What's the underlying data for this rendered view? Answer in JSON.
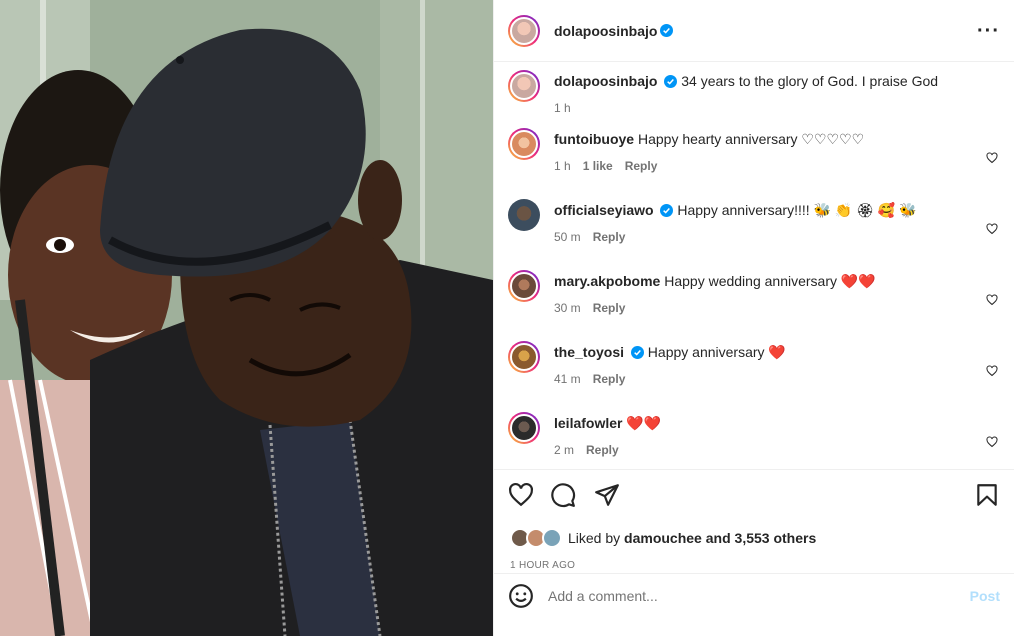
{
  "post": {
    "author": "dolapoosinbajo",
    "caption": "34 years to the glory of God. I praise God",
    "caption_time": "1 h"
  },
  "comments": [
    {
      "user": "funtoibuoye",
      "verified": false,
      "text": "Happy hearty anniversary ♡♡♡♡♡",
      "time": "1 h",
      "likes": "1 like",
      "reply": "Reply",
      "avatar_color": "#d98a5f"
    },
    {
      "user": "officialseyiawo",
      "verified": true,
      "text": "Happy anniversary!!!! 🐝 👏 🏵 🥰 🐝",
      "time": "50 m",
      "likes": "",
      "reply": "Reply",
      "avatar_color": "#3c4d5e"
    },
    {
      "user": "mary.akpobome",
      "verified": false,
      "text": "Happy wedding anniversary ❤️❤️",
      "time": "30 m",
      "likes": "",
      "reply": "Reply",
      "avatar_color": "#6b4a3a"
    },
    {
      "user": "the_toyosi",
      "verified": true,
      "text": "Happy anniversary ❤️",
      "time": "41 m",
      "likes": "",
      "reply": "Reply",
      "avatar_color": "#8a5a2e"
    },
    {
      "user": "leilafowler",
      "verified": false,
      "text": "❤️❤️",
      "time": "2 m",
      "likes": "",
      "reply": "Reply",
      "avatar_color": "#2b2b2b"
    }
  ],
  "likes": {
    "prefix": "Liked by",
    "user": "damouchee",
    "suffix": "and 3,553 others",
    "time_ago": "1 HOUR AGO"
  },
  "add_comment": {
    "placeholder": "Add a comment...",
    "post_label": "Post"
  },
  "colors": {
    "verified": "#0095f6",
    "heart_red": "#e0245e",
    "post_disabled": "#b2dffc"
  },
  "icons": [
    "more-options-icon",
    "like-icon",
    "comment-icon",
    "share-icon",
    "bookmark-icon",
    "emoji-icon",
    "verified-icon",
    "small-heart-icon"
  ]
}
